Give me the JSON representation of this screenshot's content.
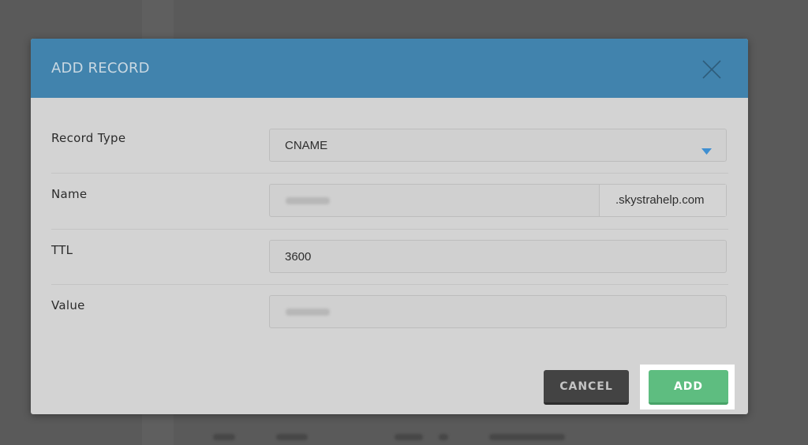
{
  "modal": {
    "title": "ADD RECORD"
  },
  "form": {
    "record_type": {
      "label": "Record Type",
      "value": "CNAME"
    },
    "name": {
      "label": "Name",
      "suffix": ".skystrahelp.com"
    },
    "ttl": {
      "label": "TTL",
      "value": "3600"
    },
    "value": {
      "label": "Value"
    }
  },
  "buttons": {
    "cancel": "CANCEL",
    "add": "ADD"
  },
  "colors": {
    "header": "#4183ad",
    "add_button": "#5ebd80",
    "cancel_button": "#434343",
    "caret": "#3f8fd1"
  },
  "icons": {
    "close": "close-icon",
    "dropdown": "caret-down-icon"
  }
}
